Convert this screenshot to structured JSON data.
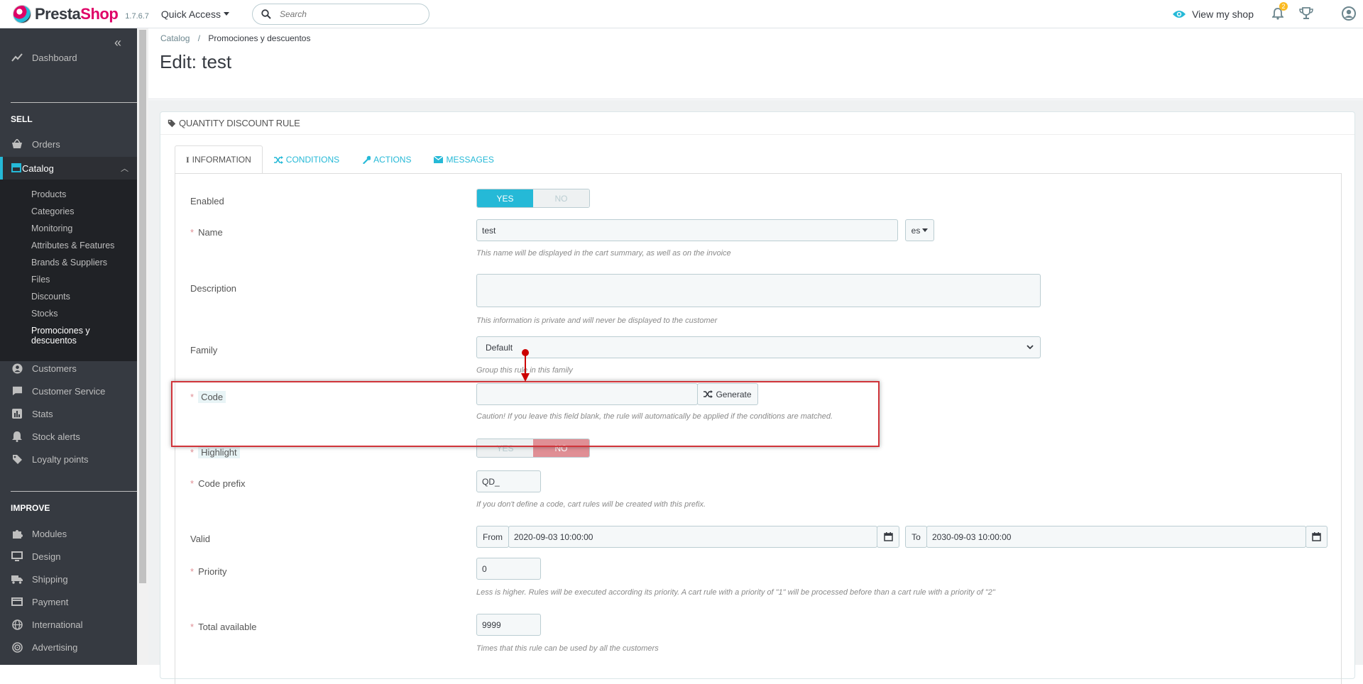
{
  "topbar": {
    "brand_a": "Presta",
    "brand_b": "Shop",
    "version": "1.7.6.7",
    "quick_access": "Quick Access",
    "search_placeholder": "Search",
    "view_shop": "View my shop",
    "notif_count": "2"
  },
  "sidebar": {
    "dashboard": "Dashboard",
    "sell": "SELL",
    "orders": "Orders",
    "catalog": "Catalog",
    "catalog_sub": [
      "Products",
      "Categories",
      "Monitoring",
      "Attributes & Features",
      "Brands & Suppliers",
      "Files",
      "Discounts",
      "Stocks",
      "Promociones y descuentos"
    ],
    "customers": "Customers",
    "customer_service": "Customer Service",
    "stats": "Stats",
    "stock_alerts": "Stock alerts",
    "loyalty": "Loyalty points",
    "improve": "IMPROVE",
    "modules": "Modules",
    "design": "Design",
    "shipping": "Shipping",
    "payment": "Payment",
    "international": "International",
    "advertising": "Advertising"
  },
  "header": {
    "breadcrumb_1": "Catalog",
    "breadcrumb_sep": "/",
    "breadcrumb_2": "Promociones y descuentos",
    "title": "Edit: test"
  },
  "panel": {
    "heading": "QUANTITY DISCOUNT RULE",
    "tabs": [
      "INFORMATION",
      "CONDITIONS",
      "ACTIONS",
      "MESSAGES"
    ]
  },
  "form": {
    "enabled_label": "Enabled",
    "yes": "YES",
    "no": "NO",
    "name_label": "Name",
    "name_value": "test",
    "lang": "es",
    "name_help": "This name will be displayed in the cart summary, as well as on the invoice",
    "description_label": "Description",
    "description_help": "This information is private and will never be displayed to the customer",
    "family_label": "Family",
    "family_value": "Default",
    "family_help": "Group this rule in this family",
    "code_label": "Code",
    "generate": "Generate",
    "code_help": "Caution! If you leave this field blank, the rule will automatically be applied if the conditions are matched.",
    "highlight_label": "Highlight",
    "prefix_label": "Code prefix",
    "prefix_value": "QD_",
    "prefix_help": "If you don't define a code, cart rules will be created with this prefix.",
    "valid_label": "Valid",
    "from": "From",
    "from_value": "2020-09-03 10:00:00",
    "to": "To",
    "to_value": "2030-09-03 10:00:00",
    "priority_label": "Priority",
    "priority_value": "0",
    "priority_help": "Less is higher. Rules will be executed according its priority. A cart rule with a priority of \"1\" will be processed before than a cart rule with a priority of \"2\"",
    "total_label": "Total available",
    "total_value": "9999",
    "total_help": "Times that this rule can be used by all the customers"
  }
}
